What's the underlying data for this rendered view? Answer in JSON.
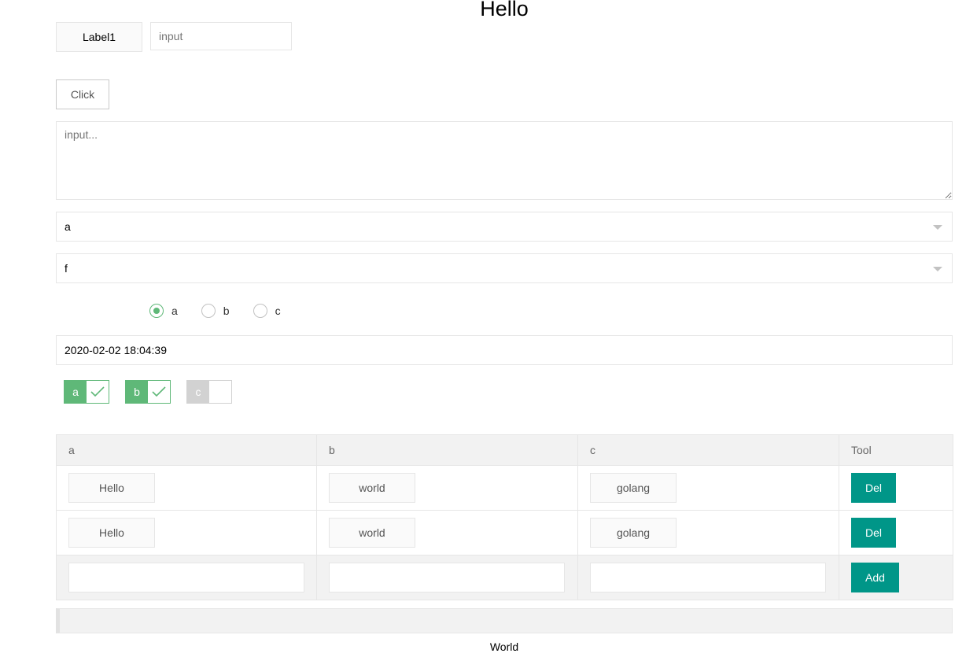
{
  "title": "Hello",
  "form": {
    "label1": "Label1",
    "input_placeholder": "input",
    "click_label": "Click",
    "textarea_placeholder": "input...",
    "select1_value": "a",
    "select2_value": "f",
    "radios": [
      {
        "label": "a",
        "checked": true
      },
      {
        "label": "b",
        "checked": false
      },
      {
        "label": "c",
        "checked": false
      }
    ],
    "datetime": "2020-02-02 18:04:39",
    "checkboxes": [
      {
        "label": "a",
        "checked": true
      },
      {
        "label": "b",
        "checked": true
      },
      {
        "label": "c",
        "checked": false
      }
    ]
  },
  "table": {
    "headers": [
      "a",
      "b",
      "c",
      "Tool"
    ],
    "rows": [
      [
        "Hello",
        "world",
        "golang"
      ],
      [
        "Hello",
        "world",
        "golang"
      ]
    ],
    "del_label": "Del",
    "add_label": "Add"
  },
  "footer": "World",
  "colors": {
    "accent_green": "#5fb878",
    "button_teal": "#009688"
  }
}
